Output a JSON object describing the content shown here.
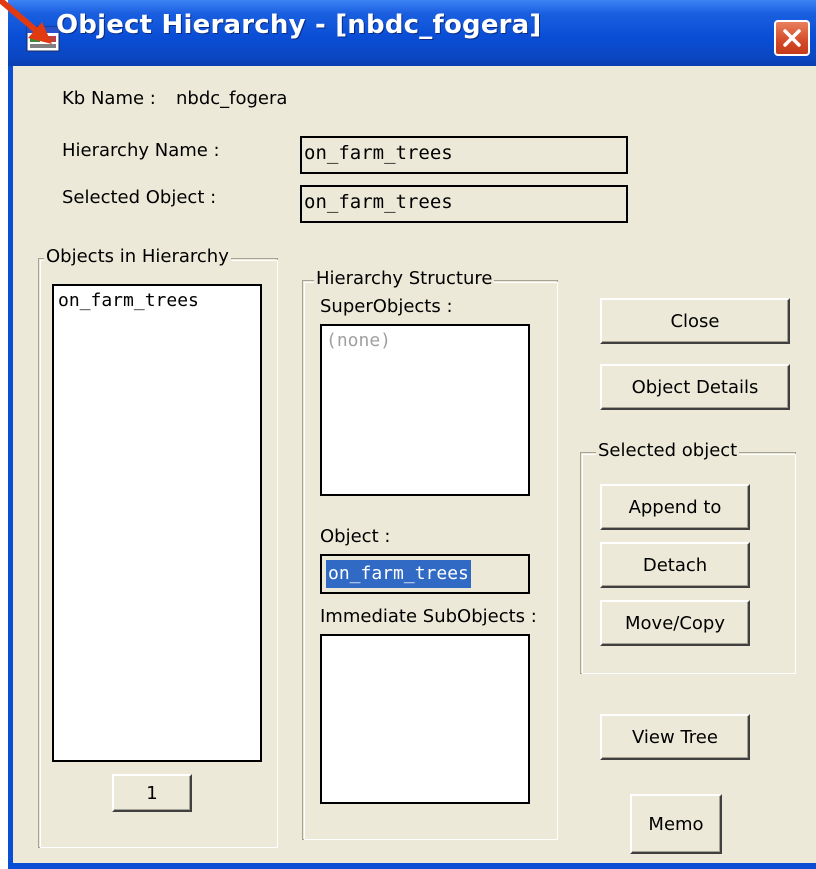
{
  "window": {
    "title": "Object Hierarchy - [nbdc_fogera]"
  },
  "info": {
    "kb_label": "Kb Name :",
    "kb_value": "nbdc_fogera",
    "hierarchy_name_label": "Hierarchy Name :",
    "hierarchy_name_value": "on_farm_trees",
    "selected_object_label": "Selected Object :",
    "selected_object_value": "on_farm_trees"
  },
  "objects_group": {
    "legend": "Objects in Hierarchy",
    "items": [
      "on_farm_trees"
    ],
    "count_button": "1"
  },
  "structure_group": {
    "legend": "Hierarchy Structure",
    "super_label": "SuperObjects :",
    "super_items": [
      "(none)"
    ],
    "object_label": "Object :",
    "object_value": "on_farm_trees",
    "sub_label": "Immediate SubObjects :"
  },
  "buttons": {
    "close": "Close",
    "object_details": "Object Details",
    "view_tree": "View Tree",
    "memo": "Memo"
  },
  "selected_group": {
    "legend": "Selected object",
    "append": "Append to",
    "detach": "Detach",
    "move_copy": "Move/Copy"
  },
  "colors": {
    "titlebar": "#0a4ed6",
    "face": "#ece9d8",
    "selection": "#316ac5",
    "close": "#d44a28"
  }
}
